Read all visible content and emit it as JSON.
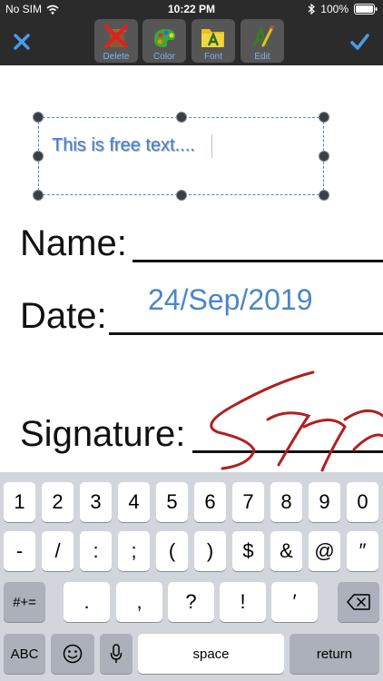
{
  "status_bar": {
    "carrier": "No SIM",
    "time": "10:22 PM",
    "battery": "100%"
  },
  "toolbar": {
    "buttons": [
      {
        "id": "delete",
        "label": "Delete"
      },
      {
        "id": "color",
        "label": "Color"
      },
      {
        "id": "font",
        "label": "Font"
      },
      {
        "id": "edit",
        "label": "Edit"
      }
    ],
    "accent_color": "#4a9be8"
  },
  "document": {
    "free_text": "This is free text....",
    "name_label": "Name:",
    "date_label": "Date:",
    "date_value": "24/Sep/2019",
    "signature_label": "Signature:",
    "annotation_color": "#4a86c8",
    "signature_color": "#b02020"
  },
  "keyboard": {
    "row1": [
      "1",
      "2",
      "3",
      "4",
      "5",
      "6",
      "7",
      "8",
      "9",
      "0"
    ],
    "row2": [
      "-",
      "/",
      ":",
      ";",
      "(",
      ")",
      "$",
      "&",
      "@",
      "″"
    ],
    "row3_left": "#+=",
    "row3_keys": [
      ".",
      ",",
      "?",
      "!",
      "′"
    ],
    "abc": "ABC",
    "space": "space",
    "return": "return"
  }
}
